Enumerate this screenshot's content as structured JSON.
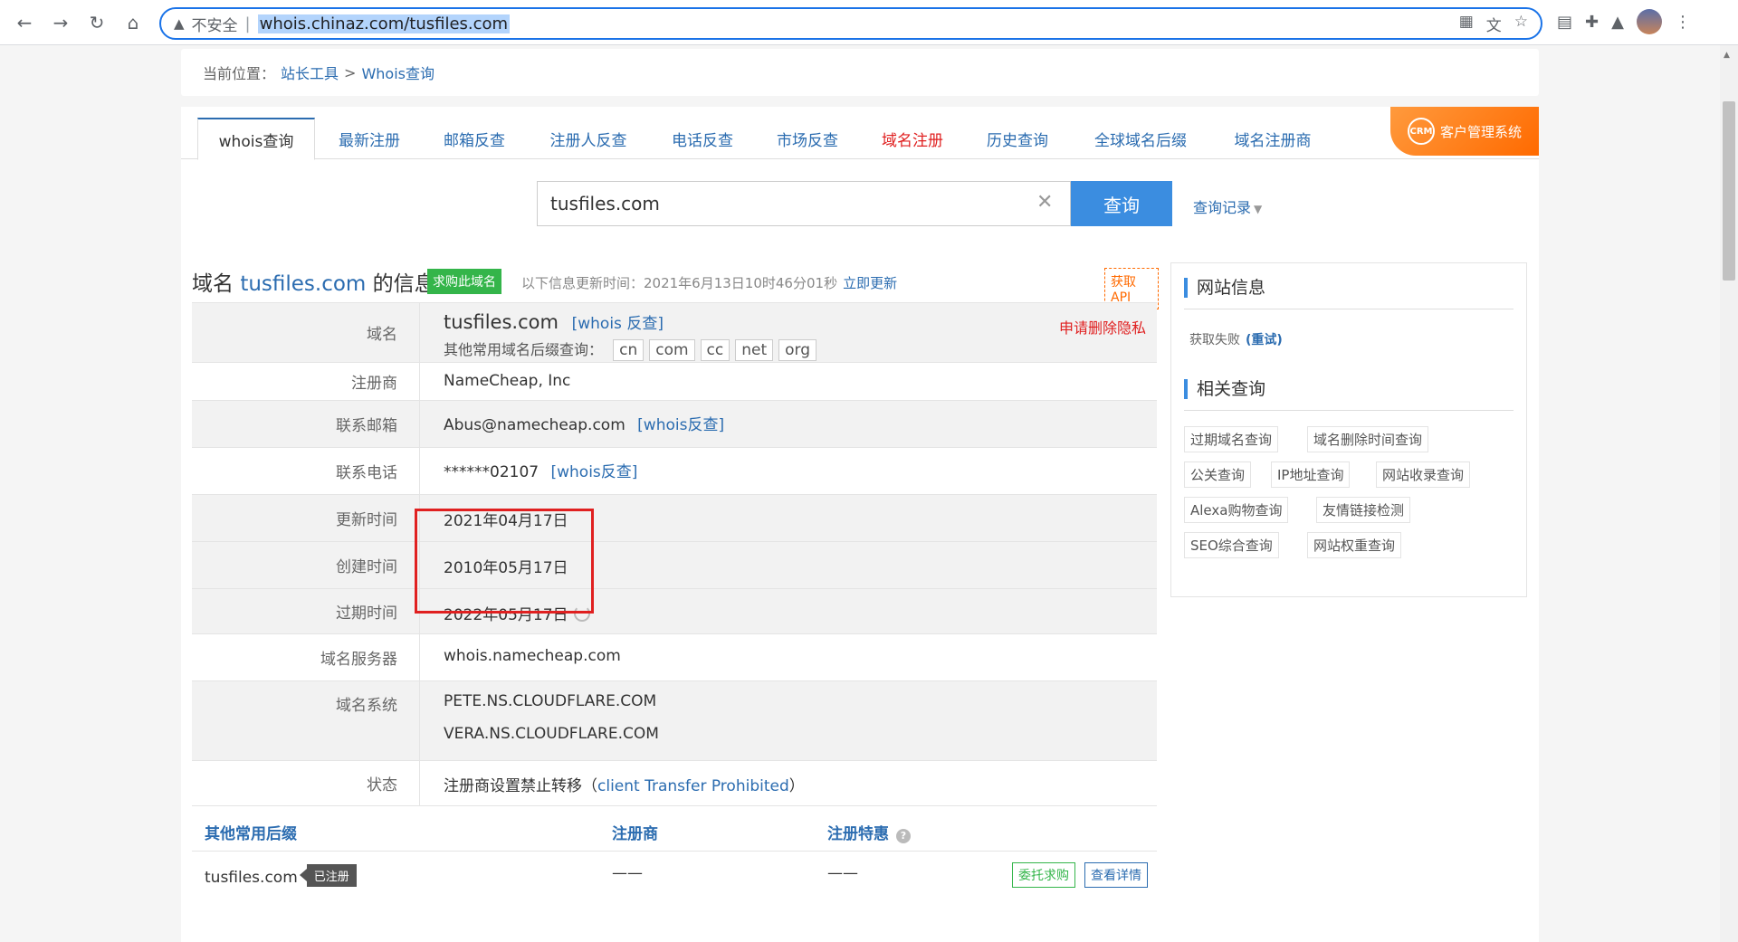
{
  "browser": {
    "insecure_label": "不安全",
    "url": "whois.chinaz.com/tusfiles.com"
  },
  "breadcrumb": {
    "prefix": "当前位置：",
    "items": [
      "站长工具",
      "Whois查询"
    ],
    "separator": ">"
  },
  "tabs": [
    {
      "label": "whois查询",
      "active": true
    },
    {
      "label": "最新注册"
    },
    {
      "label": "邮箱反查"
    },
    {
      "label": "注册人反查"
    },
    {
      "label": "电话反查"
    },
    {
      "label": "市场反查"
    },
    {
      "label": "域名注册",
      "highlight": true
    },
    {
      "label": "历史查询"
    },
    {
      "label": "全球域名后缀"
    },
    {
      "label": "域名注册商"
    }
  ],
  "crm_badge": {
    "icon_text": "CRM",
    "label": "客户管理系统"
  },
  "search": {
    "value": "tusfiles.com",
    "button": "查询",
    "history": "查询记录"
  },
  "info_head": {
    "prefix": "域名",
    "domain": "tusfiles.com",
    "suffix": "的信息",
    "buy_tag": "求购此域名",
    "update_text": "以下信息更新时间：2021年6月13日10时46分01秒",
    "update_now": "立即更新",
    "api": "获取API"
  },
  "whois": {
    "domain_label": "域名",
    "domain_value": "tusfiles.com",
    "domain_link": "[whois 反查]",
    "other_ext_label": "其他常用域名后缀查询：",
    "other_exts": [
      "cn",
      "com",
      "cc",
      "net",
      "org"
    ],
    "delete_privacy": "申请删除隐私",
    "registrar_label": "注册商",
    "registrar_value": "NameCheap, Inc",
    "email_label": "联系邮箱",
    "email_value": "Abus@namecheap.com",
    "email_link": "[whois反查]",
    "phone_label": "联系电话",
    "phone_value": "******02107",
    "phone_link": "[whois反查]",
    "updated_label": "更新时间",
    "updated_value": "2021年04月17日",
    "created_label": "创建时间",
    "created_value": "2010年05月17日",
    "expires_label": "过期时间",
    "expires_value": "2022年05月17日",
    "server_label": "域名服务器",
    "server_value": "whois.namecheap.com",
    "dns_label": "域名系统",
    "dns_values": [
      "PETE.NS.CLOUDFLARE.COM",
      "VERA.NS.CLOUDFLARE.COM"
    ],
    "status_label": "状态",
    "status_value": "注册商设置禁止转移（",
    "status_link": "client Transfer Prohibited",
    "status_close": "）"
  },
  "suffix_table": {
    "headers": [
      "其他常用后缀",
      "注册商",
      "注册特惠"
    ],
    "help": "?",
    "rows": [
      {
        "domain": "tusfiles.com",
        "tag": "已注册",
        "registrar": "——",
        "offer": "——",
        "btn1": "委托求购",
        "btn2": "查看详情"
      }
    ]
  },
  "sidebar": {
    "site_info_title": "网站信息",
    "fail_text": "获取失败",
    "retry_text": "(重试)",
    "related_title": "相关查询",
    "chips": [
      "过期域名查询",
      "域名删除时间查询",
      "公关查询",
      "IP地址查询",
      "网站收录查询",
      "Alexa购物查询",
      "友情链接检测",
      "SEO综合查询",
      "网站权重查询"
    ]
  }
}
